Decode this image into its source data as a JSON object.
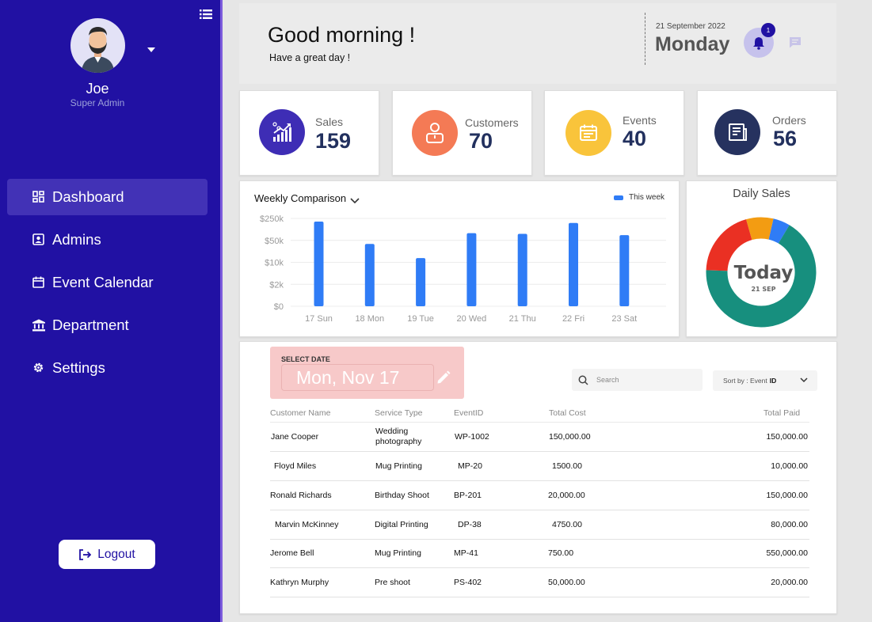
{
  "sidebar": {
    "user_name": "Joe",
    "user_role": "Super Admin",
    "nav": [
      {
        "label": "Dashboard",
        "icon": "dashboard-icon",
        "active": true
      },
      {
        "label": "Admins",
        "icon": "admin-icon"
      },
      {
        "label": "Event Calendar",
        "icon": "calendar-icon"
      },
      {
        "label": "Department",
        "icon": "bank-icon"
      },
      {
        "label": "Settings",
        "icon": "gear-icon"
      }
    ],
    "logout_label": "Logout"
  },
  "header": {
    "greeting": "Good morning !",
    "subgreeting": "Have a great day !",
    "date": "21 September 2022",
    "day": "Monday",
    "notification_count": "1"
  },
  "stats": [
    {
      "label": "Sales",
      "value": "159",
      "color": "#3e2db5",
      "icon": "sales-chart-icon"
    },
    {
      "label": "Customers",
      "value": "70",
      "color": "#f47a55",
      "icon": "customer-icon"
    },
    {
      "label": "Events",
      "value": "40",
      "color": "#f9c43b",
      "icon": "calendar-icon"
    },
    {
      "label": "Orders",
      "value": "56",
      "color": "#26325f",
      "icon": "receipt-icon"
    }
  ],
  "colors": {
    "sidebar": "#2111a3",
    "accent": "#2f7cf6",
    "date_card": "#f7c9c9"
  },
  "weekly": {
    "title": "Weekly Comparison",
    "legend": "This week"
  },
  "daily": {
    "title": "Daily Sales",
    "center_label": "Today",
    "center_sub": "21 SEP"
  },
  "chart_data": [
    {
      "type": "bar",
      "title": "Weekly Comparison",
      "categories": [
        "17 Sun",
        "18 Mon",
        "19 Tue",
        "20 Wed",
        "21 Thu",
        "22 Fri",
        "23 Sat"
      ],
      "y_ticks": [
        "$250k",
        "$50k",
        "$10k",
        "$2k",
        "$0"
      ],
      "series": [
        {
          "name": "This week",
          "values": [
            4.82,
            3.55,
            2.74,
            4.16,
            4.12,
            4.74,
            4.05
          ]
        }
      ],
      "y_scale": "categorical-log-ticks",
      "ylim": [
        0,
        5
      ],
      "grid": true,
      "legend_position": "top-right"
    },
    {
      "type": "pie",
      "title": "Daily Sales",
      "donut": true,
      "slices": [
        {
          "color": "#178f7e",
          "value": 67
        },
        {
          "color": "#ea3023",
          "value": 20
        },
        {
          "color": "#f39c12",
          "value": 8
        },
        {
          "color": "#2f7cf6",
          "value": 5
        }
      ]
    }
  ],
  "table": {
    "select_date_label": "SELECT DATE",
    "date_value": "Mon, Nov 17",
    "search_placeholder": "Search",
    "sort_prefix": "Sort by : Event",
    "sort_value": "ID",
    "columns": [
      "Customer Name",
      "Service Type",
      "EventID",
      "Total Cost",
      "Total Paid"
    ],
    "rows": [
      {
        "name": "Jane Cooper",
        "service": "Wedding photography",
        "event": "WP-1002",
        "cost": "150,000.00",
        "paid": "150,000.00"
      },
      {
        "name": "Floyd Miles",
        "service": "Mug Printing",
        "event": "MP-20",
        "cost": "1500.00",
        "paid": "10,000.00"
      },
      {
        "name": "Ronald Richards",
        "service": "Birthday Shoot",
        "event": "BP-201",
        "cost": "20,000.00",
        "paid": "150,000.00"
      },
      {
        "name": "Marvin McKinney",
        "service": "Digital Printing",
        "event": "DP-38",
        "cost": "4750.00",
        "paid": "80,000.00"
      },
      {
        "name": "Jerome Bell",
        "service": "Mug Printing",
        "event": "MP-41",
        "cost": "750.00",
        "paid": "550,000.00"
      },
      {
        "name": "Kathryn Murphy",
        "service": "Pre shoot",
        "event": "PS-402",
        "cost": "50,000.00",
        "paid": "20,000.00"
      }
    ]
  }
}
